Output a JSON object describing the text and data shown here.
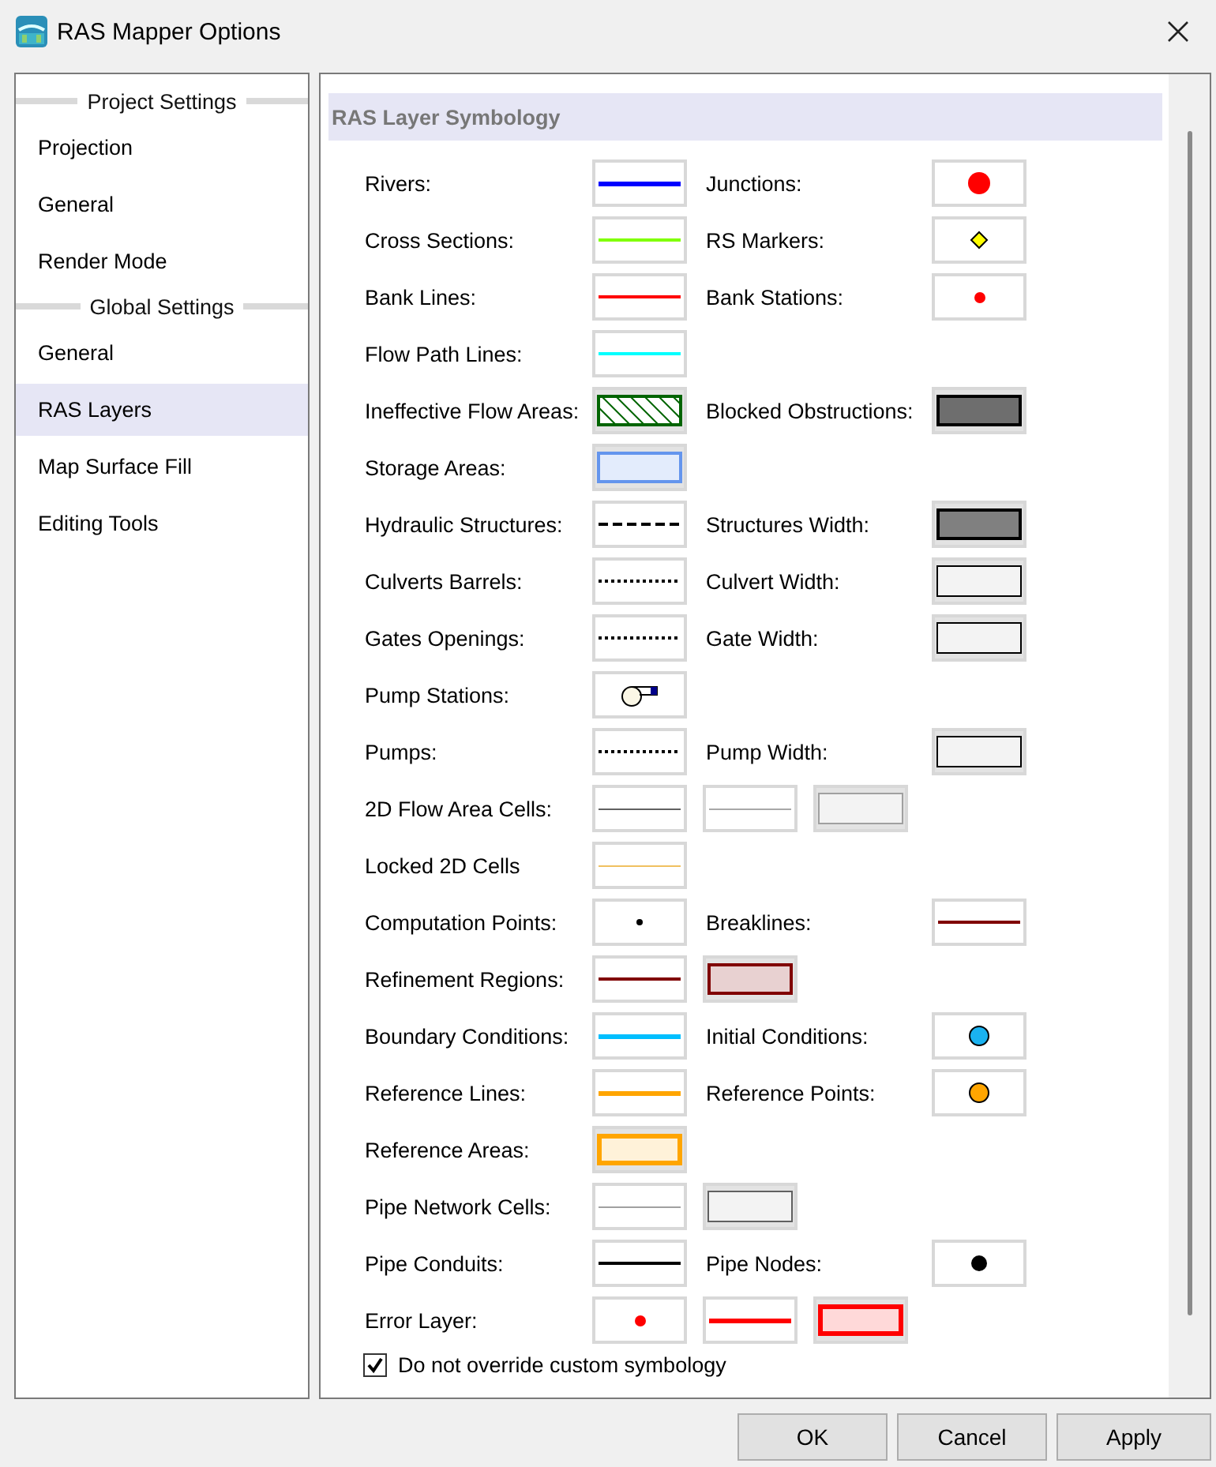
{
  "window": {
    "title": "RAS Mapper Options"
  },
  "sidebar": {
    "items": [
      {
        "kind": "heading",
        "label": "Project Settings"
      },
      {
        "kind": "item",
        "label": "Projection",
        "selected": false
      },
      {
        "kind": "item",
        "label": "General",
        "selected": false
      },
      {
        "kind": "item",
        "label": "Render Mode",
        "selected": false
      },
      {
        "kind": "heading",
        "label": "Global Settings"
      },
      {
        "kind": "item",
        "label": "General",
        "selected": false
      },
      {
        "kind": "item",
        "label": "RAS Layers",
        "selected": true
      },
      {
        "kind": "item",
        "label": "Map Surface Fill",
        "selected": false
      },
      {
        "kind": "item",
        "label": "Editing Tools",
        "selected": false
      }
    ]
  },
  "panel": {
    "title": "RAS Layer Symbology",
    "rows": [
      {
        "label": "Rivers:",
        "swatches": [
          {
            "kind": "thickline",
            "color": "#0000ff"
          }
        ],
        "right": {
          "label": "Junctions:",
          "swatch": {
            "kind": "bigdot",
            "color": "#ff0000"
          }
        }
      },
      {
        "label": "Cross Sections:",
        "swatches": [
          {
            "kind": "line",
            "color": "#80ff00"
          }
        ],
        "right": {
          "label": "RS Markers:",
          "swatch": {
            "kind": "diamond",
            "color": "#ffff00"
          }
        }
      },
      {
        "label": "Bank Lines:",
        "swatches": [
          {
            "kind": "line",
            "color": "#ff0000"
          }
        ],
        "right": {
          "label": "Bank Stations:",
          "swatch": {
            "kind": "smalldot",
            "color": "#ff0000"
          }
        }
      },
      {
        "label": "Flow Path Lines:",
        "swatches": [
          {
            "kind": "line",
            "color": "#00ffff"
          }
        ]
      },
      {
        "label": "Ineffective Flow Areas:",
        "swatches": [
          {
            "kind": "hatch",
            "color": "#006400"
          }
        ],
        "right": {
          "label": "Blocked Obstructions:",
          "swatch": {
            "kind": "block",
            "color": "#6e6e6e"
          }
        }
      },
      {
        "label": "Storage Areas:",
        "swatches": [
          {
            "kind": "area",
            "color": "#6495ed"
          }
        ]
      },
      {
        "label": "Hydraulic Structures:",
        "swatches": [
          {
            "kind": "dashed",
            "color": "#000000"
          }
        ],
        "right": {
          "label": "Structures Width:",
          "swatch": {
            "kind": "block",
            "color": "#808080"
          }
        }
      },
      {
        "label": "Culverts Barrels:",
        "swatches": [
          {
            "kind": "dotted",
            "color": "#000000"
          }
        ],
        "right": {
          "label": "Culvert Width:",
          "swatch": {
            "kind": "box",
            "color": "#000000"
          }
        }
      },
      {
        "label": "Gates Openings:",
        "swatches": [
          {
            "kind": "dotted",
            "color": "#000000"
          }
        ],
        "right": {
          "label": "Gate Width:",
          "swatch": {
            "kind": "box",
            "color": "#000000"
          }
        }
      },
      {
        "label": "Pump Stations:",
        "swatches": [
          {
            "kind": "pump",
            "color": "#00008b"
          }
        ]
      },
      {
        "label": "Pumps:",
        "swatches": [
          {
            "kind": "dotted",
            "color": "#000000"
          }
        ],
        "right": {
          "label": "Pump Width:",
          "swatch": {
            "kind": "box",
            "color": "#000000"
          }
        }
      },
      {
        "label": "2D Flow Area Cells:",
        "swatches": [
          {
            "kind": "thinline",
            "color": "#606060"
          },
          {
            "kind": "thinline",
            "color": "#a8a8a8"
          },
          {
            "kind": "box",
            "color": "#a0a0a0"
          }
        ]
      },
      {
        "label": "Locked 2D Cells",
        "swatches": [
          {
            "kind": "thinline",
            "color": "#f0c060"
          }
        ]
      },
      {
        "label": "Computation Points:",
        "swatches": [
          {
            "kind": "tinydot",
            "color": "#000000"
          }
        ],
        "right": {
          "label": "Breaklines:",
          "swatch": {
            "kind": "line",
            "color": "#800000"
          }
        }
      },
      {
        "label": "Refinement Regions:",
        "swatches": [
          {
            "kind": "line",
            "color": "#800000"
          },
          {
            "kind": "area",
            "color": "#800000"
          }
        ]
      },
      {
        "label": "Boundary Conditions:",
        "swatches": [
          {
            "kind": "thickline",
            "color": "#00bfff"
          }
        ],
        "right": {
          "label": "Initial Conditions:",
          "swatch": {
            "kind": "circle",
            "color": "#1ab2f0"
          }
        }
      },
      {
        "label": "Reference Lines:",
        "swatches": [
          {
            "kind": "thickline",
            "color": "#ffa500"
          }
        ],
        "right": {
          "label": "Reference Points:",
          "swatch": {
            "kind": "circle",
            "color": "#ffa500"
          }
        }
      },
      {
        "label": "Reference Areas:",
        "swatches": [
          {
            "kind": "thickarea",
            "color": "#ffa500"
          }
        ]
      },
      {
        "label": "Pipe Network Cells:",
        "swatches": [
          {
            "kind": "thinline",
            "color": "#a0a0a0"
          },
          {
            "kind": "box",
            "color": "#606060"
          }
        ]
      },
      {
        "label": "Pipe Conduits:",
        "swatches": [
          {
            "kind": "line",
            "color": "#000000"
          }
        ],
        "right": {
          "label": "Pipe Nodes:",
          "swatch": {
            "kind": "dot",
            "color": "#000000"
          }
        }
      },
      {
        "label": "Error Layer:",
        "swatches": [
          {
            "kind": "smalldot",
            "color": "#ff0000"
          },
          {
            "kind": "thickline",
            "color": "#ff0000"
          },
          {
            "kind": "thickarea",
            "color": "#ff0000"
          }
        ]
      }
    ],
    "checkbox": {
      "label": "Do not override custom symbology",
      "checked": true
    }
  },
  "buttons": [
    "OK",
    "Cancel",
    "Apply"
  ]
}
